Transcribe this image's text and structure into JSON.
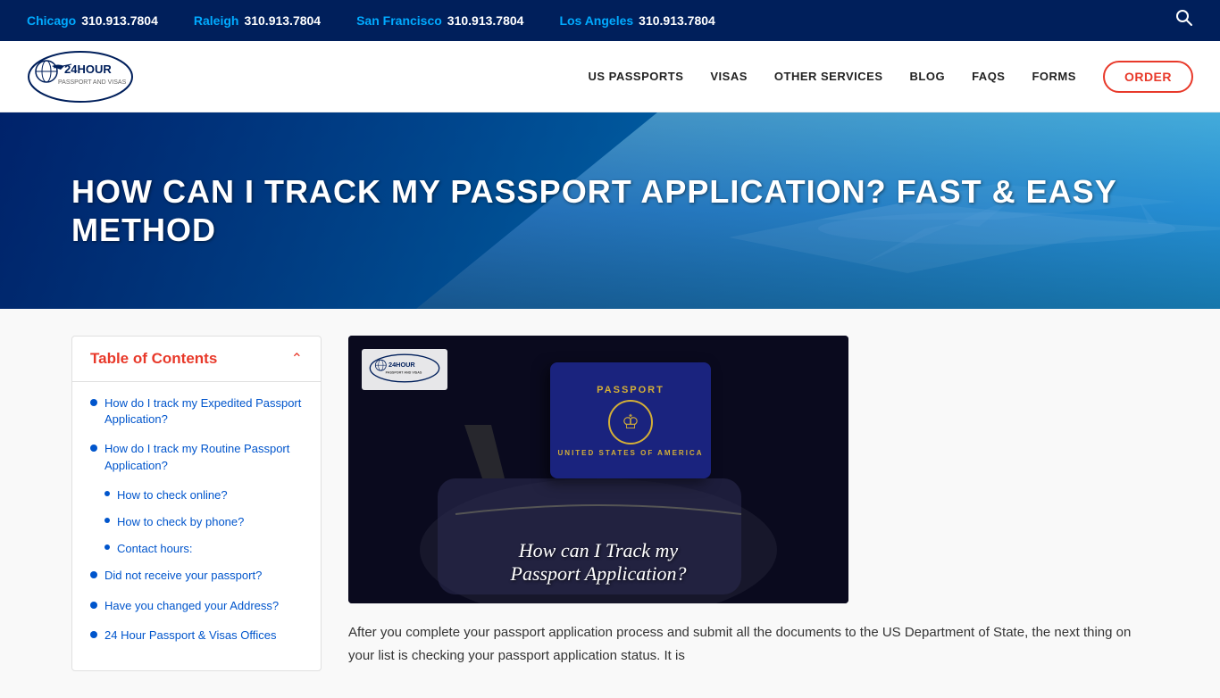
{
  "topbar": {
    "locations": [
      {
        "city": "Chicago",
        "phone": "310.913.7804"
      },
      {
        "city": "Raleigh",
        "phone": "310.913.7804"
      },
      {
        "city": "San Francisco",
        "phone": "310.913.7804"
      },
      {
        "city": "Los Angeles",
        "phone": "310.913.7804"
      }
    ]
  },
  "nav": {
    "logo_text": "24HOUR",
    "logo_sub": "PASSPORT AND VISAS",
    "links": [
      {
        "label": "US PASSPORTS"
      },
      {
        "label": "VISAS"
      },
      {
        "label": "OTHER SERVICES"
      },
      {
        "label": "BLOG"
      },
      {
        "label": "FAQS"
      },
      {
        "label": "FORMS"
      }
    ],
    "order_label": "ORDER"
  },
  "hero": {
    "title": "HOW CAN I TRACK MY PASSPORT APPLICATION? FAST & EASY METHOD"
  },
  "toc": {
    "title": "Table of Contents",
    "items": [
      {
        "label": "How do I track my Expedited Passport Application?",
        "sub": false
      },
      {
        "label": "How do I track my Routine Passport Application?",
        "sub": false
      },
      {
        "label": "How to check online?",
        "sub": true
      },
      {
        "label": "How to check by phone?",
        "sub": true
      },
      {
        "label": "Contact hours:",
        "sub": true
      },
      {
        "label": "Did not receive your passport?",
        "sub": false
      },
      {
        "label": "Have you changed your Address?",
        "sub": false
      },
      {
        "label": "24 Hour Passport & Visas Offices",
        "sub": false
      }
    ]
  },
  "article": {
    "image_caption_line1": "How can I Track my",
    "image_caption_line2": "Passport Application?",
    "logo_overlay": "24HOUR",
    "paragraph": "After you complete your passport application process and submit all the documents to the US Department of State, the next thing on your list is checking your passport application status. It is"
  }
}
